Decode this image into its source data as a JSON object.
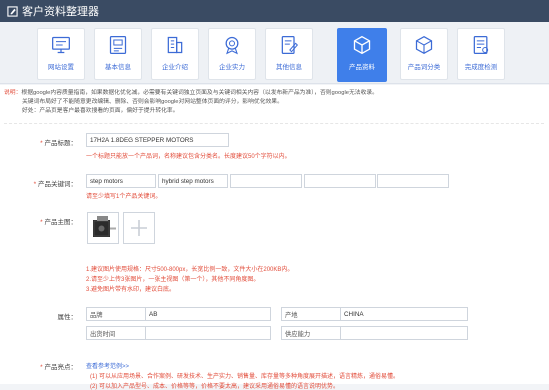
{
  "app": {
    "title": "客户资料整理器"
  },
  "tabs": [
    {
      "label": "网站设置",
      "icon": "monitor-icon"
    },
    {
      "label": "基本信息",
      "icon": "id-card-icon"
    },
    {
      "label": "企业介绍",
      "icon": "building-icon"
    },
    {
      "label": "企业实力",
      "icon": "medal-icon"
    },
    {
      "label": "其他信息",
      "icon": "edit-doc-icon"
    },
    {
      "label": "产品资料",
      "icon": "cube-icon",
      "active": true
    },
    {
      "label": "产品词分类",
      "icon": "cube-outline-icon"
    },
    {
      "label": "完成度检测",
      "icon": "checklist-icon"
    }
  ],
  "note": {
    "prefix": "说明：",
    "line1": "根据google内容质量指南，如果数据化优化减，必需要有关键词独立页面及与关键词相关内容（以发布新产品为准），否则google无法收录。",
    "line2": "关键词布局好了不能随意更改编辑、删除、否则会影响google对网站整体页面的评分，影响优化效果。",
    "line3": "好处：产品页是客户最喜欢搜看的页面，偏好于提升转化率。"
  },
  "form": {
    "title_label": "产品标题：",
    "title_value": "17H2A 1.8DEG STEPPER MOTORS",
    "title_tip": "一个标题只能放一个产品词，名称建议包含分类名。长度建议50个字符以内。",
    "keyword_label": "产品关键词：",
    "keywords": [
      "step motors",
      "hybrid step motors",
      "",
      "",
      ""
    ],
    "keyword_tip": "请至少填写1个产品关键词。",
    "image_label": "产品主图：",
    "image_tips": [
      "1.建议图片使用规格：尺寸500-800px，长宽比例一致，文件大小在200KB内。",
      "2.请至少上传3张图片，一张主视图（第一个），其他不同角度图。",
      "3.避免图片带有水印，建议白底。"
    ],
    "attr_label": "属性：",
    "attrs": [
      {
        "name": "品牌",
        "value": "AB"
      },
      {
        "name": "产地",
        "value": "CHINA"
      },
      {
        "name": "出货时间",
        "value": ""
      },
      {
        "name": "供应能力",
        "value": ""
      }
    ],
    "desc_label": "产品亮点：",
    "desc_link": "查看参考范例>>",
    "desc_tip1": "(1) 可以从应用场景、合作案例、研发技术、生产实力、销售量、库存量等多种角度展开描述，语言精炼，通俗易懂。",
    "desc_tip2": "(2) 可以加入产品型号、成本、价格等等，价格不要太高，建议采用通俗易懂的语言说明优势。"
  }
}
